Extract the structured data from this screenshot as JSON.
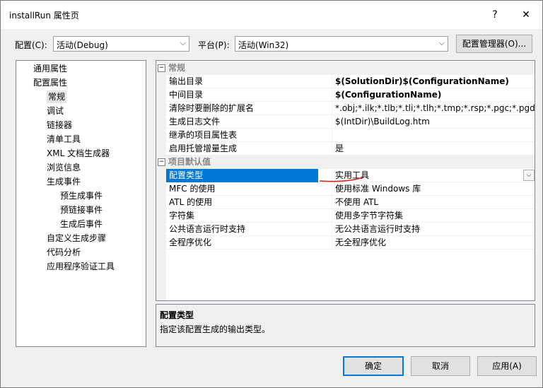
{
  "window": {
    "title": "installRun 属性页",
    "help_label": "?",
    "close_label": "✕"
  },
  "toolbar": {
    "config_label": "配置(C):",
    "config_value": "活动(Debug)",
    "platform_label": "平台(P):",
    "platform_value": "活动(Win32)",
    "config_manager_label": "配置管理器(O)..."
  },
  "tree": {
    "items": [
      {
        "label": "通用属性",
        "level": 1
      },
      {
        "label": "配置属性",
        "level": 1
      },
      {
        "label": "常规",
        "level": 2,
        "selected": true
      },
      {
        "label": "调试",
        "level": 2
      },
      {
        "label": "链接器",
        "level": 2
      },
      {
        "label": "清单工具",
        "level": 2
      },
      {
        "label": "XML 文档生成器",
        "level": 2
      },
      {
        "label": "浏览信息",
        "level": 2
      },
      {
        "label": "生成事件",
        "level": 2
      },
      {
        "label": "预生成事件",
        "level": 3
      },
      {
        "label": "预链接事件",
        "level": 3
      },
      {
        "label": "生成后事件",
        "level": 3
      },
      {
        "label": "自定义生成步骤",
        "level": 2
      },
      {
        "label": "代码分析",
        "level": 2
      },
      {
        "label": "应用程序验证工具",
        "level": 2
      }
    ]
  },
  "grid": {
    "categories": [
      {
        "label": "常规",
        "expander": "−",
        "rows": [
          {
            "name": "输出目录",
            "value": "$(SolutionDir)$(ConfigurationName)",
            "bold": true
          },
          {
            "name": "中间目录",
            "value": "$(ConfigurationName)",
            "bold": true
          },
          {
            "name": "清除时要删除的扩展名",
            "value": "*.obj;*.ilk;*.tlb;*.tli;*.tlh;*.tmp;*.rsp;*.pgc;*.pgd;*.meta;$"
          },
          {
            "name": "生成日志文件",
            "value": "$(IntDir)\\BuildLog.htm"
          },
          {
            "name": "继承的项目属性表",
            "value": ""
          },
          {
            "name": "启用托管增量生成",
            "value": "是"
          }
        ]
      },
      {
        "label": "项目默认值",
        "expander": "−",
        "rows": [
          {
            "name": "配置类型",
            "value": "实用工具",
            "selected": true
          },
          {
            "name": "MFC 的使用",
            "value": "使用标准 Windows 库"
          },
          {
            "name": "ATL 的使用",
            "value": "不使用 ATL"
          },
          {
            "name": "字符集",
            "value": "使用多字节字符集"
          },
          {
            "name": "公共语言运行时支持",
            "value": "无公共语言运行时支持"
          },
          {
            "name": "全程序优化",
            "value": "无全程序优化"
          }
        ]
      }
    ]
  },
  "description": {
    "title": "配置类型",
    "text": "指定该配置生成的输出类型。"
  },
  "buttons": {
    "ok": "确定",
    "cancel": "取消",
    "apply": "应用(A)"
  },
  "colors": {
    "selection": "#0078d7",
    "annotation": "#e0201a"
  }
}
